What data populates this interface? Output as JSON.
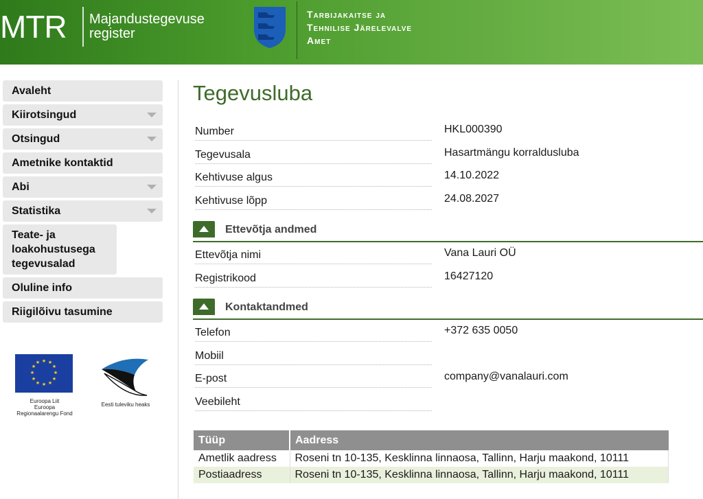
{
  "header": {
    "logo": "MTR",
    "logo_sub_line1": "Majandustegevuse",
    "logo_sub_line2": "register",
    "agency_line1": "Tarbijakaitse ja",
    "agency_line2": "Tehnilise Järelevalve",
    "agency_line3": "Amet"
  },
  "sidebar": {
    "items": [
      {
        "label": "Avaleht",
        "has_arrow": false
      },
      {
        "label": "Kiirotsingud",
        "has_arrow": true
      },
      {
        "label": "Otsingud",
        "has_arrow": true
      },
      {
        "label": "Ametnike kontaktid",
        "has_arrow": false
      },
      {
        "label": "Abi",
        "has_arrow": true
      },
      {
        "label": "Statistika",
        "has_arrow": true
      },
      {
        "label": "Teate- ja loakohustusega tegevusalad",
        "has_arrow": false
      },
      {
        "label": "Oluline info",
        "has_arrow": false
      },
      {
        "label": "Riigilõivu tasumine",
        "has_arrow": false
      }
    ],
    "eu_caption_line1": "Euroopa Liit",
    "eu_caption_line2": "Euroopa",
    "eu_caption_line3": "Regionaalarengu Fond",
    "ee_caption": "Eesti tuleviku heaks"
  },
  "main": {
    "title": "Tegevusluba",
    "fields": [
      {
        "label": "Number",
        "value": "HKL000390"
      },
      {
        "label": "Tegevusala",
        "value": "Hasartmängu korraldusluba"
      },
      {
        "label": "Kehtivuse algus",
        "value": "14.10.2022"
      },
      {
        "label": "Kehtivuse lõpp",
        "value": "24.08.2027"
      }
    ],
    "section_company": "Ettevõtja andmed",
    "company_fields": [
      {
        "label": "Ettevõtja nimi",
        "value": "Vana Lauri OÜ"
      },
      {
        "label": "Registrikood",
        "value": "16427120"
      }
    ],
    "section_contact": "Kontaktandmed",
    "contact_fields": [
      {
        "label": "Telefon",
        "value": "+372 635 0050"
      },
      {
        "label": "Mobiil",
        "value": ""
      },
      {
        "label": "E-post",
        "value": "company@vanalauri.com"
      },
      {
        "label": "Veebileht",
        "value": ""
      }
    ],
    "address_table": {
      "headers": [
        "Tüüp",
        "Aadress"
      ],
      "rows": [
        [
          "Ametlik aadress",
          "Roseni tn 10-135, Kesklinna linnaosa, Tallinn, Harju maakond, 10111"
        ],
        [
          "Postiaadress",
          "Roseni tn 10-135, Kesklinna linnaosa, Tallinn, Harju maakond, 10111"
        ]
      ]
    }
  },
  "colors": {
    "accent_green": "#3e6b2a",
    "header_green": "#4a9a2c",
    "row_highlight": "#e9f1dc"
  }
}
